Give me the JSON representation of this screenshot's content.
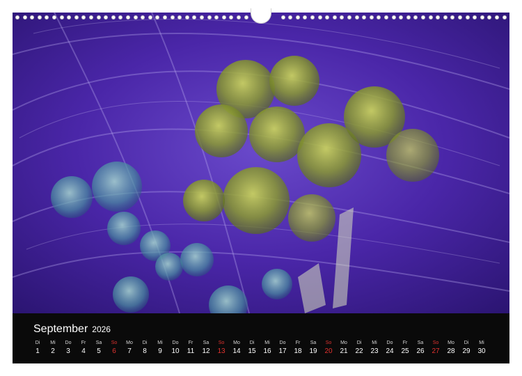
{
  "calendar": {
    "month": "September",
    "year": "2026",
    "colors": {
      "background": "#0a0a0a",
      "text": "#ffffff",
      "sunday": "#e0322f"
    },
    "days": [
      {
        "wd": "Di",
        "n": "1"
      },
      {
        "wd": "Mi",
        "n": "2"
      },
      {
        "wd": "Do",
        "n": "3"
      },
      {
        "wd": "Fr",
        "n": "4"
      },
      {
        "wd": "Sa",
        "n": "5"
      },
      {
        "wd": "So",
        "n": "6",
        "sun": true
      },
      {
        "wd": "Mo",
        "n": "7"
      },
      {
        "wd": "Di",
        "n": "8"
      },
      {
        "wd": "Mi",
        "n": "9"
      },
      {
        "wd": "Do",
        "n": "10"
      },
      {
        "wd": "Fr",
        "n": "11"
      },
      {
        "wd": "Sa",
        "n": "12"
      },
      {
        "wd": "So",
        "n": "13",
        "sun": true
      },
      {
        "wd": "Mo",
        "n": "14"
      },
      {
        "wd": "Di",
        "n": "15"
      },
      {
        "wd": "Mi",
        "n": "16"
      },
      {
        "wd": "Do",
        "n": "17"
      },
      {
        "wd": "Fr",
        "n": "18"
      },
      {
        "wd": "Sa",
        "n": "19"
      },
      {
        "wd": "So",
        "n": "20",
        "sun": true
      },
      {
        "wd": "Mo",
        "n": "21"
      },
      {
        "wd": "Di",
        "n": "22"
      },
      {
        "wd": "Mi",
        "n": "23"
      },
      {
        "wd": "Do",
        "n": "24"
      },
      {
        "wd": "Fr",
        "n": "25"
      },
      {
        "wd": "Sa",
        "n": "26"
      },
      {
        "wd": "So",
        "n": "27",
        "sun": true
      },
      {
        "wd": "Mo",
        "n": "28"
      },
      {
        "wd": "Di",
        "n": "29"
      },
      {
        "wd": "Mi",
        "n": "30"
      }
    ]
  },
  "photo": {
    "colors": {
      "violet": "#5b2fc0",
      "deep": "#2a1470",
      "lilac": "#a890e0",
      "olive": "#9aa83a",
      "teal": "#4aa0a0"
    }
  }
}
